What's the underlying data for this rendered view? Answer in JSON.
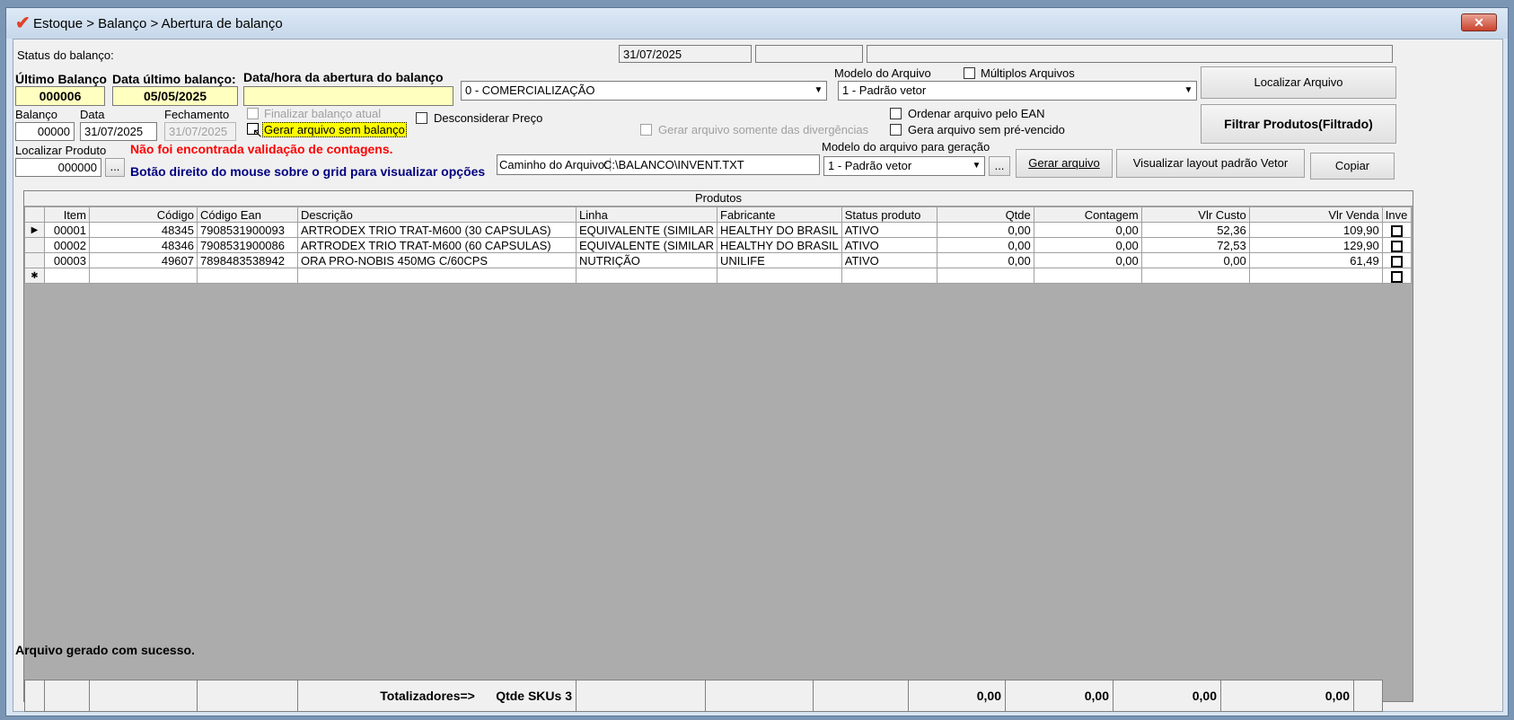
{
  "window": {
    "title": "Estoque > Balanço > Abertura de balanço",
    "close_label": "✕"
  },
  "status": {
    "label": "Status do balanço:",
    "date": "31/07/2025",
    "box2": "",
    "box3": ""
  },
  "ultimo_balanco": {
    "label": "Último Balanço",
    "value": "000006"
  },
  "data_ultimo": {
    "label": "Data último balanço:",
    "value": "05/05/2025"
  },
  "abertura": {
    "label": "Data/hora da abertura do balanço",
    "value": ""
  },
  "tipo_combo": {
    "value": "0 - COMERCIALIZAÇÃO"
  },
  "modelo_arquivo": {
    "label": "Modelo do Arquivo",
    "value": "1 - Padrão vetor"
  },
  "multiplos": {
    "label": "Múltiplos Arquivos"
  },
  "buttons": {
    "localizar_arquivo": "Localizar Arquivo",
    "filtrar": "Filtrar Produtos(Filtrado)",
    "gerar_arquivo": "Gerar arquivo",
    "visualizar_layout": "Visualizar layout padrão Vetor",
    "copiar": "Copiar",
    "ellipsis": "..."
  },
  "balanco": {
    "label": "Balanço",
    "value": "00000"
  },
  "data": {
    "label": "Data",
    "value": "31/07/2025"
  },
  "fechamento": {
    "label": "Fechamento",
    "value": "31/07/2025"
  },
  "checks": {
    "finalizar": "Finalizar balanço atual",
    "gerar_sem_balanco": "Gerar arquivo sem balanço",
    "desconsiderar": "Desconsiderar Preço",
    "somente_divergencias": "Gerar arquivo somente das divergências",
    "ordenar_ean": "Ordenar arquivo pelo EAN",
    "sem_pre_vencido": "Gera arquivo sem pré-vencido"
  },
  "localizar_produto": {
    "label": "Localizar Produto",
    "value": "000000"
  },
  "warnings": {
    "validacao": "Não foi encontrada validação de contagens.",
    "dica": "Botão direito do mouse sobre o grid para visualizar opções"
  },
  "caminho": {
    "label": "Caminho do Arquivo:",
    "value": "C:\\BALANCO\\INVENT.TXT"
  },
  "modelo_geracao": {
    "label": "Modelo do arquivo para geração",
    "value": "1 - Padrão vetor"
  },
  "grid": {
    "title": "Produtos",
    "columns": [
      "Item",
      "Código",
      "Código Ean",
      "Descrição",
      "Linha",
      "Fabricante",
      "Status produto",
      "Qtde",
      "Contagem",
      "Vlr Custo",
      "Vlr Venda",
      "Inve"
    ],
    "rows": [
      [
        "00001",
        "48345",
        "7908531900093",
        "ARTRODEX TRIO TRAT-M600 (30 CAPSULAS)",
        "EQUIVALENTE (SIMILAR",
        "HEALTHY DO BRASIL",
        "ATIVO",
        "0,00",
        "0,00",
        "52,36",
        "109,90"
      ],
      [
        "00002",
        "48346",
        "7908531900086",
        "ARTRODEX TRIO TRAT-M600 (60 CAPSULAS)",
        "EQUIVALENTE (SIMILAR",
        "HEALTHY DO BRASIL",
        "ATIVO",
        "0,00",
        "0,00",
        "72,53",
        "129,90"
      ],
      [
        "00003",
        "49607",
        "7898483538942",
        "ORA PRO-NOBIS 450MG C/60CPS",
        "NUTRIÇÃO",
        "UNILIFE",
        "ATIVO",
        "0,00",
        "0,00",
        "0,00",
        "61,49"
      ]
    ],
    "row_indicator": "▶",
    "new_row_indicator": "✱"
  },
  "totals": {
    "label": "Totalizadores=>",
    "skus": "Qtde SKUs 3",
    "qtde": "0,00",
    "contagem": "0,00",
    "custo": "0,00",
    "venda": "0,00"
  },
  "statusbar": {
    "message": "Arquivo gerado com sucesso."
  }
}
